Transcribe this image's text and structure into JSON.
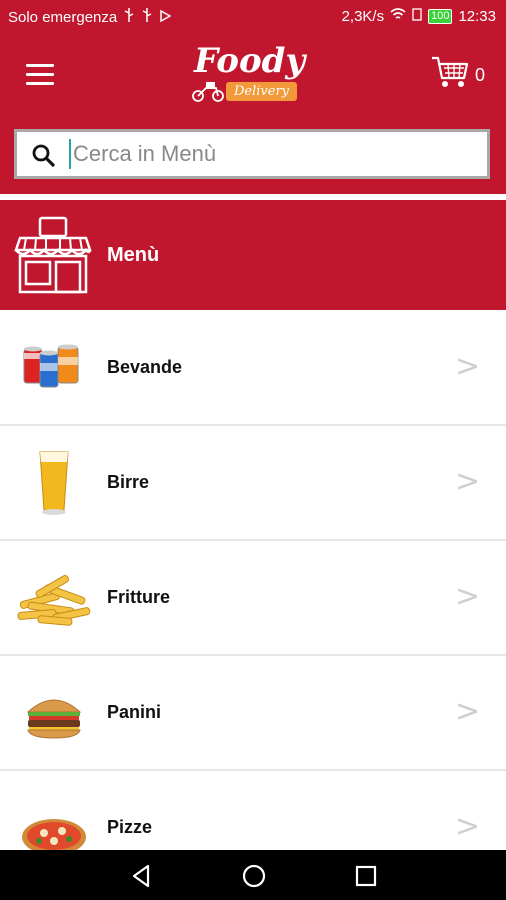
{
  "status_bar": {
    "carrier": "Solo emergenza",
    "speed": "2,3K/s",
    "battery": "100",
    "time": "12:33"
  },
  "header": {
    "logo_title": "Foody",
    "logo_badge": "Delivery",
    "cart_count": "0"
  },
  "search": {
    "placeholder": "Cerca in Menù"
  },
  "section": {
    "title": "Menù"
  },
  "menu_items": [
    {
      "label": "Bevande",
      "chevron": ">"
    },
    {
      "label": "Birre",
      "chevron": ">"
    },
    {
      "label": "Fritture",
      "chevron": ">"
    },
    {
      "label": "Panini",
      "chevron": ">"
    },
    {
      "label": "Pizze",
      "chevron": ">"
    }
  ],
  "colors": {
    "brand": "#c0172f",
    "accent": "#f29a3a"
  }
}
